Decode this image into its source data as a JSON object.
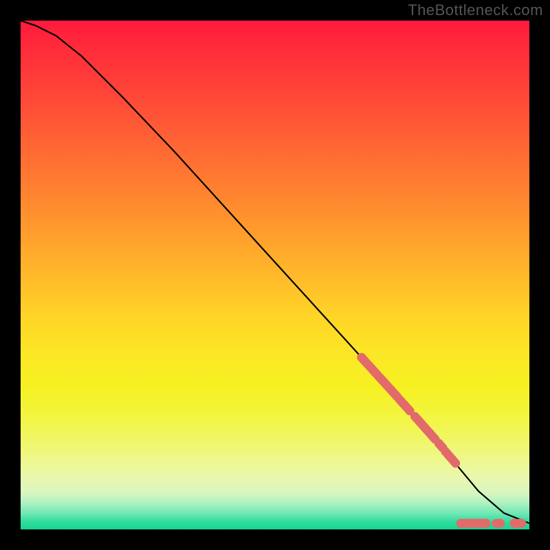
{
  "watermark": "TheBottleneck.com",
  "chart_data": {
    "type": "line",
    "title": "",
    "xlabel": "",
    "ylabel": "",
    "xlim": [
      0,
      100
    ],
    "ylim": [
      0,
      100
    ],
    "grid": false,
    "series": [
      {
        "name": "curve",
        "color": "#000000",
        "x": [
          0,
          3,
          7,
          12,
          20,
          30,
          40,
          50,
          60,
          70,
          78,
          85,
          90,
          95,
          100
        ],
        "y": [
          100,
          99,
          97,
          93,
          85,
          74.5,
          63.5,
          52.5,
          41.5,
          30.5,
          21.5,
          13.5,
          7.5,
          3.2,
          1.2
        ]
      },
      {
        "name": "highlight-points",
        "color": "#e36a6a",
        "marker": "circle",
        "segments": [
          {
            "start": {
              "x": 67,
              "y": 33.8
            },
            "end": {
              "x": 74,
              "y": 26.1
            },
            "dense": true
          },
          {
            "start": {
              "x": 74.5,
              "y": 25.5
            },
            "end": {
              "x": 76.5,
              "y": 23.3
            },
            "dense": true
          },
          {
            "start": {
              "x": 77.5,
              "y": 22.2
            },
            "end": {
              "x": 81.5,
              "y": 17.7
            },
            "dense": true
          },
          {
            "start": {
              "x": 82.2,
              "y": 16.9
            },
            "end": {
              "x": 83,
              "y": 16
            },
            "dense": true
          },
          {
            "start": {
              "x": 83.5,
              "y": 15.3
            },
            "end": {
              "x": 85.5,
              "y": 13
            },
            "dense": true
          },
          {
            "start": {
              "x": 86.5,
              "y": 1.2
            },
            "end": {
              "x": 91.5,
              "y": 1.2
            },
            "dense": true
          },
          {
            "start": {
              "x": 93.5,
              "y": 1.2
            },
            "end": {
              "x": 94.3,
              "y": 1.2
            },
            "dense": true
          },
          {
            "start": {
              "x": 97,
              "y": 1.2
            },
            "end": {
              "x": 98.5,
              "y": 1.2
            },
            "dense": true
          }
        ]
      }
    ]
  }
}
